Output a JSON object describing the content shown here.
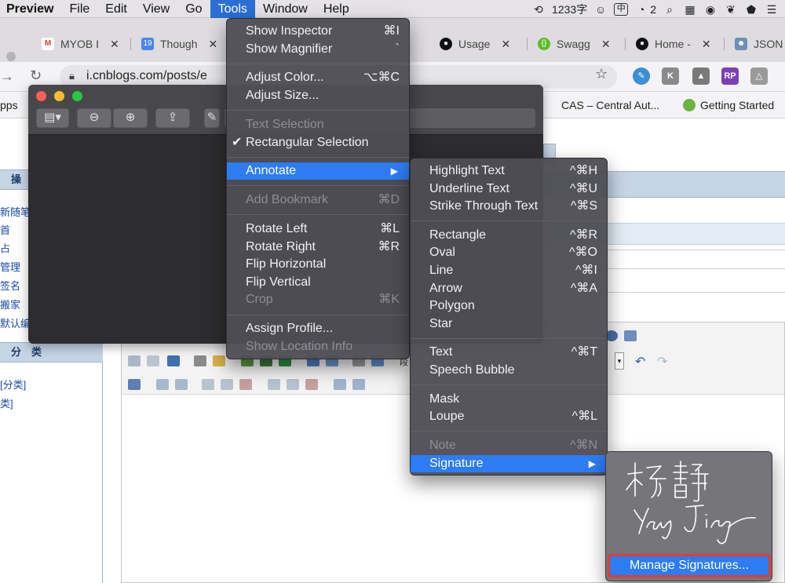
{
  "menubar": {
    "app": "Preview",
    "items": [
      "File",
      "Edit",
      "View",
      "Go",
      "Tools",
      "Window",
      "Help"
    ],
    "active_item": "Tools",
    "status": {
      "word_count": "1233字",
      "input_method": "中",
      "notification_count": "2"
    }
  },
  "tabs": [
    {
      "title": "MYOB I",
      "icon": "gmail-icon",
      "color": "#d44638"
    },
    {
      "title": "Though",
      "icon": "calendar-icon",
      "color": "#4a86e8"
    },
    {
      "title": "Usage",
      "icon": "github-icon",
      "color": "#111111"
    },
    {
      "title": "Swagg",
      "icon": "swagger-icon",
      "color": "#5bbd2b"
    },
    {
      "title": "Home -",
      "icon": "github-icon",
      "color": "#111111"
    },
    {
      "title": "JSON",
      "icon": "avatar-icon",
      "color": "#6e8fb6"
    }
  ],
  "url": "i.cnblogs.com/posts/e",
  "bookmarks": {
    "apps": "pps",
    "cas": "CAS – Central Aut...",
    "getting_started": "Getting Started"
  },
  "page": {
    "sidebar_header1": "操",
    "sidebar_links": [
      "新随笔",
      "首",
      "占",
      "管理",
      "签名",
      "搬家",
      "默认编辑"
    ],
    "sidebar_header2": "分　类",
    "category_links": [
      "[分类]",
      "类]"
    ],
    "toolbar_ab": "段"
  },
  "preview_window": {
    "buttons": [
      "sidebar-toggle",
      "zoom-out",
      "zoom-in",
      "share",
      "markup"
    ]
  },
  "tools_menu": {
    "items": [
      {
        "label": "Show Inspector",
        "shortcut": "⌘I",
        "disabled": false
      },
      {
        "label": "Show Magnifier",
        "shortcut": "`",
        "disabled": false
      },
      {
        "label": "Adjust Color...",
        "shortcut": "⌥⌘C",
        "disabled": false
      },
      {
        "label": "Adjust Size...",
        "shortcut": "",
        "disabled": false
      },
      {
        "label": "Text Selection",
        "shortcut": "",
        "disabled": true
      },
      {
        "label": "Rectangular Selection",
        "shortcut": "",
        "disabled": false,
        "checked": true
      },
      {
        "label": "Annotate",
        "shortcut": "",
        "disabled": false,
        "highlighted": true,
        "submenu": true
      },
      {
        "label": "Add Bookmark",
        "shortcut": "⌘D",
        "disabled": true
      },
      {
        "label": "Rotate Left",
        "shortcut": "⌘L",
        "disabled": false
      },
      {
        "label": "Rotate Right",
        "shortcut": "⌘R",
        "disabled": false
      },
      {
        "label": "Flip Horizontal",
        "shortcut": "",
        "disabled": false
      },
      {
        "label": "Flip Vertical",
        "shortcut": "",
        "disabled": false
      },
      {
        "label": "Crop",
        "shortcut": "⌘K",
        "disabled": true
      },
      {
        "label": "Assign Profile...",
        "shortcut": "",
        "disabled": false
      },
      {
        "label": "Show Location Info",
        "shortcut": "",
        "disabled": true
      }
    ]
  },
  "annotate_menu": {
    "items": [
      {
        "label": "Highlight Text",
        "shortcut": "^⌘H"
      },
      {
        "label": "Underline Text",
        "shortcut": "^⌘U"
      },
      {
        "label": "Strike Through Text",
        "shortcut": "^⌘S"
      },
      {
        "label": "Rectangle",
        "shortcut": "^⌘R"
      },
      {
        "label": "Oval",
        "shortcut": "^⌘O"
      },
      {
        "label": "Line",
        "shortcut": "^⌘I"
      },
      {
        "label": "Arrow",
        "shortcut": "^⌘A"
      },
      {
        "label": "Polygon",
        "shortcut": ""
      },
      {
        "label": "Star",
        "shortcut": ""
      },
      {
        "label": "Text",
        "shortcut": "^⌘T"
      },
      {
        "label": "Speech Bubble",
        "shortcut": ""
      },
      {
        "label": "Mask",
        "shortcut": ""
      },
      {
        "label": "Loupe",
        "shortcut": "^⌘L"
      },
      {
        "label": "Note",
        "shortcut": "^⌘N",
        "disabled": true
      },
      {
        "label": "Signature",
        "shortcut": "",
        "highlighted": true,
        "submenu": true
      }
    ]
  },
  "signature_panel": {
    "signature_chinese": "杨静",
    "signature_latin": "Yang Jing",
    "manage_label": "Manage Signatures..."
  }
}
